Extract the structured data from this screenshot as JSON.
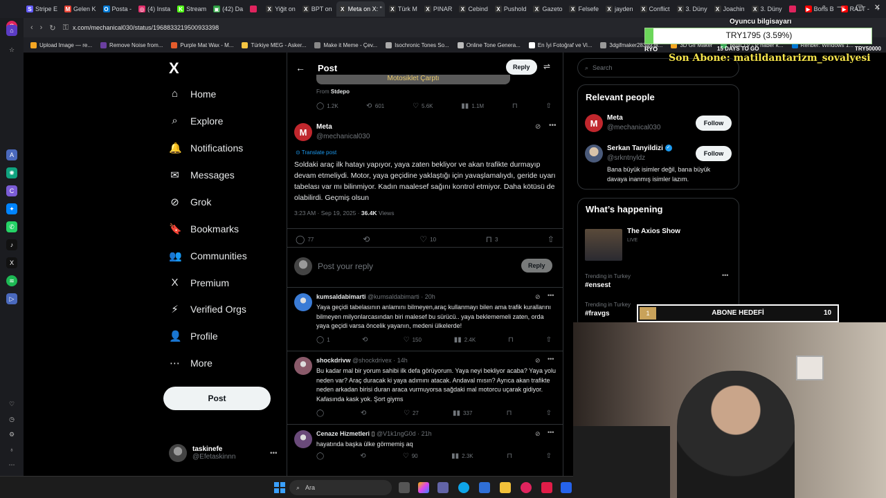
{
  "browser": {
    "tabs": [
      {
        "label": "Stripe E",
        "color": "#635bff",
        "glyph": "S"
      },
      {
        "label": "Gelen K",
        "color": "#ea4335",
        "glyph": "M"
      },
      {
        "label": "Posta -",
        "color": "#0078d4",
        "glyph": "O"
      },
      {
        "label": "(4) Insta",
        "color": "#e1306c",
        "glyph": "◎"
      },
      {
        "label": "Stream",
        "color": "#53fc18",
        "glyph": "K"
      },
      {
        "label": "(42) Da",
        "color": "#2ea043",
        "glyph": "▣"
      },
      {
        "label": "",
        "color": "#e0245e",
        "glyph": ""
      },
      {
        "label": "Yiğit on",
        "color": "#333333",
        "glyph": "X"
      },
      {
        "label": "BPT on",
        "color": "#333333",
        "glyph": "X"
      },
      {
        "label": "Meta on X: \"",
        "color": "#333333",
        "glyph": "X",
        "active": true
      },
      {
        "label": "Türk M",
        "color": "#333333",
        "glyph": "X"
      },
      {
        "label": "PINAR",
        "color": "#333333",
        "glyph": "X"
      },
      {
        "label": "Cebind",
        "color": "#333333",
        "glyph": "X"
      },
      {
        "label": "Pushold",
        "color": "#333333",
        "glyph": "X"
      },
      {
        "label": "Gazeto",
        "color": "#333333",
        "glyph": "X"
      },
      {
        "label": "Felsefe",
        "color": "#333333",
        "glyph": "X"
      },
      {
        "label": "jayden",
        "color": "#333333",
        "glyph": "X"
      },
      {
        "label": "Conflict",
        "color": "#333333",
        "glyph": "X"
      },
      {
        "label": "3. Düny",
        "color": "#333333",
        "glyph": "X"
      },
      {
        "label": "Joachin",
        "color": "#333333",
        "glyph": "X"
      },
      {
        "label": "3. Düny",
        "color": "#333333",
        "glyph": "X"
      },
      {
        "label": "",
        "color": "#e0245e",
        "glyph": ""
      },
      {
        "label": "Boris B",
        "color": "#ff0000",
        "glyph": "▶"
      },
      {
        "label": "RATT -",
        "color": "#ff0000",
        "glyph": "▶"
      },
      {
        "label": "+",
        "color": "",
        "glyph": ""
      }
    ],
    "url": "x.com/mechanical030/status/1968833219500933398",
    "bookmarks": [
      {
        "label": "Upload Image — re...",
        "color": "#f5a623"
      },
      {
        "label": "Remove Noise from...",
        "color": "#6b3fa0"
      },
      {
        "label": "Purple Mat Wax - M...",
        "color": "#e55c2c"
      },
      {
        "label": "Türkiye MEG - Asker...",
        "color": "#f5c542"
      },
      {
        "label": "Make it Meme - Çev...",
        "color": "#888888"
      },
      {
        "label": "Isochronic Tones So...",
        "color": "#aaaaaa"
      },
      {
        "label": "Online Tone Genera...",
        "color": "#bbbbbb"
      },
      {
        "label": "En İyi Fotoğraf ve Vi...",
        "color": "#ffffff"
      },
      {
        "label": "3dgifmaker28349.gi...",
        "color": "#999999"
      },
      {
        "label": "3D Gif Maker",
        "color": "#f5a623"
      },
      {
        "label": "Multi TV - P haber k...",
        "color": "#3aa757"
      },
      {
        "label": "Rehber: Windows 1...",
        "color": "#0078d4"
      }
    ]
  },
  "leftnav": {
    "logo": "X",
    "items": [
      {
        "icon": "⌂",
        "label": "Home",
        "name": "home"
      },
      {
        "icon": "⌕",
        "label": "Explore",
        "name": "explore"
      },
      {
        "icon": "🔔",
        "label": "Notifications",
        "name": "notifications"
      },
      {
        "icon": "✉",
        "label": "Messages",
        "name": "messages"
      },
      {
        "icon": "⊘",
        "label": "Grok",
        "name": "grok"
      },
      {
        "icon": "🔖",
        "label": "Bookmarks",
        "name": "bookmarks"
      },
      {
        "icon": "👥",
        "label": "Communities",
        "name": "communities"
      },
      {
        "icon": "X",
        "label": "Premium",
        "name": "premium"
      },
      {
        "icon": "⚡",
        "label": "Verified Orgs",
        "name": "verified-orgs"
      },
      {
        "icon": "👤",
        "label": "Profile",
        "name": "profile"
      },
      {
        "icon": "⋯",
        "label": "More",
        "name": "more"
      }
    ],
    "post_label": "Post",
    "account": {
      "name": "taskinefe",
      "handle": "@Efetaskinnn"
    }
  },
  "main": {
    "title": "Post",
    "reply_label": "Reply",
    "embed_caption": "Motosiklet Çarptı",
    "from_prefix": "From",
    "from_source": "Stdepo",
    "prev_actions": {
      "replies": "1.2K",
      "reposts": "601",
      "likes": "5.6K",
      "views": "1.1M"
    },
    "tweet": {
      "name": "Meta",
      "handle": "@mechanical030",
      "translate": "Translate post",
      "text": "Soldaki araç ilk hatayı yapıyor, yaya zaten bekliyor ve akan trafikte durmayıp devam etmeliydi. Motor, yaya geçidine yaklaştığı için yavaşlamalıydı, geride uyarı tabelası var mı bilinmiyor. Kadın maalesef sağını kontrol etmiyor. Daha kötüsü de olabilirdi. Geçmiş olsun",
      "time": "3:23 AM · Sep 19, 2025 · ",
      "views": "36.4K",
      "views_label": " Views",
      "replies": "77",
      "likes": "10",
      "bookmarks": "3"
    },
    "reply_placeholder": "Post your reply",
    "reply_button": "Reply",
    "replies": [
      {
        "name": "kumsaldabimarti",
        "handle": "@kumsaldabimarti · 20h",
        "text": "Yaya geçidi tabelasının anlamını bilmeyen,araç kullanmayı bilen ama trafik kurallarını bilmeyen milyonlarcasından biri malesef bu sürücü.. yaya beklememeli zaten, orda yaya geçidi varsa öncelik yayanın, medeni ülkelerde!",
        "replies": "1",
        "reposts": "",
        "likes": "150",
        "views": "2.4K",
        "avatar": "#3a7bd5"
      },
      {
        "name": "shockdrivw",
        "handle": "@shockdrivex · 14h",
        "text": "Bu kadar mal bir yorum sahibi ilk defa görüyorum. Yaya neyi bekliyor acaba? Yaya yolu neden var? Araç duracak ki yaya adımını atacak. Andaval mısın? Ayrıca akan trafikte neden arkadan birisi duran araca vurmuyorsa sağdaki mal motorcu uçarak gidiyor. Kafasında kask yok. Şort giyms",
        "replies": "",
        "reposts": "",
        "likes": "27",
        "views": "337",
        "avatar": "#8a5a6a"
      },
      {
        "name": "Cenaze Hizmetleri ▯",
        "handle": "@V1k1ngG0d · 21h",
        "text": "hayatında başka ülke görmemiş aq",
        "replies": "",
        "reposts": "",
        "likes": "90",
        "views": "2.3K",
        "avatar": "#6a4a7a"
      }
    ]
  },
  "right": {
    "search_placeholder": "Search",
    "relevant_title": "Relevant people",
    "people": [
      {
        "name": "Meta",
        "handle": "@mechanical030",
        "follow": "Follow",
        "avatar_glyph": "M"
      },
      {
        "name": "Serkan Tanyildizi",
        "handle": "@srkntnyldz",
        "follow": "Follow",
        "bio": "Bana büyük isimler değil, bana büyük davaya inanmış isimler lazım."
      }
    ],
    "happening_title": "What’s happening",
    "show_title": "The Axios Show",
    "show_status": "LIVE",
    "trends": [
      {
        "context": "Trending in Turkey",
        "tag": "#ensest"
      },
      {
        "context": "Trending in Turkey",
        "tag": "#fravgs"
      }
    ]
  },
  "overlay": {
    "title": "Oyuncu bilgisayarı",
    "progress_label": "TRY1795 (3.59%)",
    "progress_fraction": 0.0359,
    "left_label": "RYO",
    "goal_label": "15 DAYS TO GO",
    "right_label": "TRY50000",
    "subscriber": "Son Abone: matildantarizm_sovalyesi",
    "abone_index": "1",
    "abone_label": "ABONE HEDEFİ",
    "abone_target": "10"
  },
  "taskbar": {
    "search": "Ara"
  }
}
